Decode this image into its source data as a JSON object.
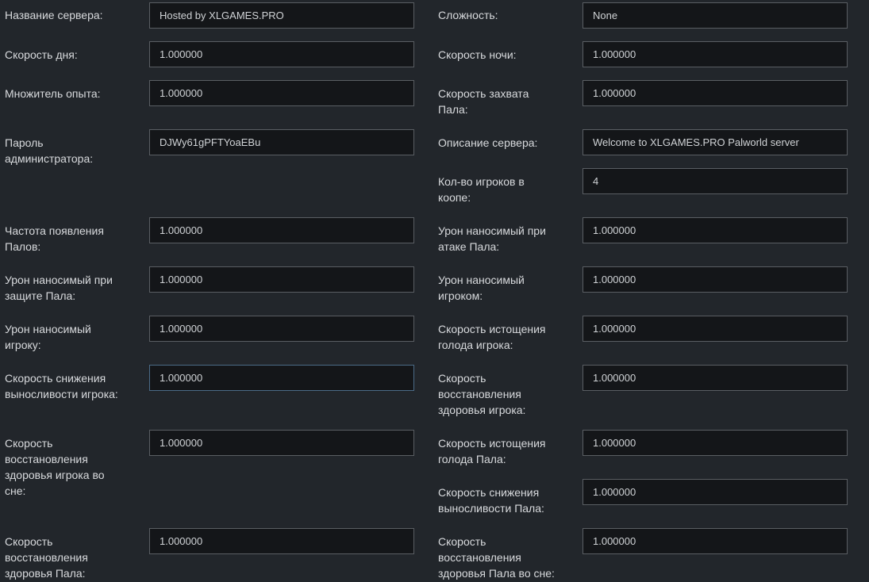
{
  "left": [
    {
      "id": "server-name",
      "label": "Название сервера:",
      "value": "Hosted by XLGAMES.PRO"
    },
    {
      "id": "day-speed",
      "label": "Скорость дня:",
      "value": "1.000000"
    },
    {
      "id": "exp-rate",
      "label": "Множитель опыта:",
      "value": "1.000000"
    },
    {
      "id": "admin-password",
      "label": "Пароль администратора:",
      "value": "DJWy61gPFTYoaEBu"
    },
    {
      "id": "pal-spawn-rate",
      "label": "Частота появления Палов:",
      "value": "1.000000"
    },
    {
      "id": "pal-defense-damage",
      "label": "Урон наносимый при защите Пала:",
      "value": "1.000000"
    },
    {
      "id": "damage-to-player",
      "label": "Урон наносимый игроку:",
      "value": "1.000000"
    },
    {
      "id": "player-stamina-decrease",
      "label": "Скорость снижения выносливости игрока:",
      "value": "1.000000"
    },
    {
      "id": "player-sleep-hp-regen",
      "label": "Скорость восстановления здоровья игрока во сне:",
      "value": "1.000000"
    },
    {
      "id": "pal-hp-regen",
      "label": "Скорость восстановления здоровья Пала:",
      "value": "1.000000"
    }
  ],
  "right": [
    {
      "id": "difficulty",
      "label": "Сложность:",
      "value": "None"
    },
    {
      "id": "night-speed",
      "label": "Скорость ночи:",
      "value": "1.000000"
    },
    {
      "id": "pal-capture-rate",
      "label": "Скорость захвата Пала:",
      "value": "1.000000"
    },
    {
      "id": "server-description",
      "label": "Описание сервера:",
      "value": "Welcome to XLGAMES.PRO Palworld server"
    },
    {
      "id": "coop-players",
      "label": "Кол-во игроков в коопе:",
      "value": "4"
    },
    {
      "id": "pal-attack-damage",
      "label": "Урон наносимый при атаке Пала:",
      "value": "1.000000"
    },
    {
      "id": "player-damage",
      "label": "Урон наносимый игроком:",
      "value": "1.000000"
    },
    {
      "id": "player-hunger-rate",
      "label": "Скорость истощения голода игрока:",
      "value": "1.000000"
    },
    {
      "id": "player-hp-regen",
      "label": "Скорость восстановления здоровья игрока:",
      "value": "1.000000"
    },
    {
      "id": "pal-hunger-rate",
      "label": "Скорость истощения голода Пала:",
      "value": "1.000000"
    },
    {
      "id": "pal-stamina-decrease",
      "label": "Скорость снижения выносливости Пала:",
      "value": "1.000000"
    },
    {
      "id": "pal-sleep-hp-regen",
      "label": "Скорость восстановления здоровья Пала во сне:",
      "value": "1.000000"
    }
  ]
}
